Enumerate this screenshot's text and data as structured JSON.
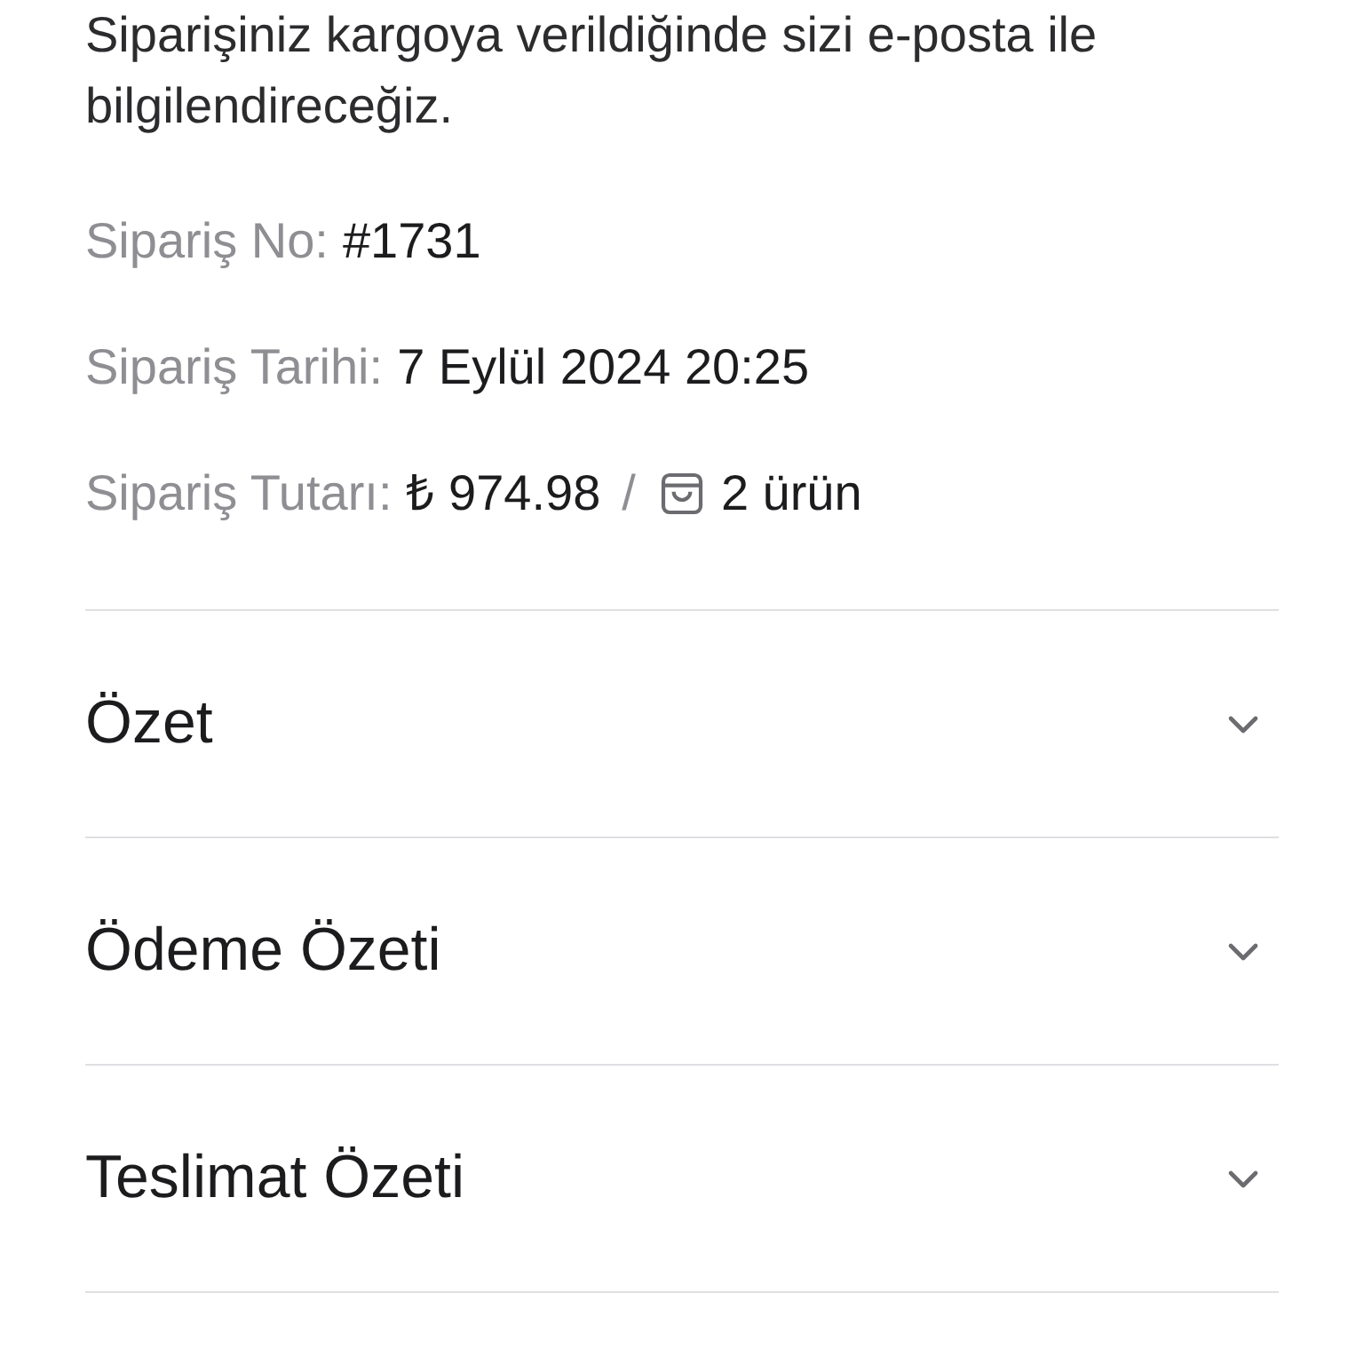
{
  "message": "Siparişiniz kargoya verildiğinde sizi e-posta ile bilgilendireceğiz.",
  "order": {
    "number_label": "Sipariş No:",
    "number": "#1731",
    "date_label": "Sipariş Tarihi:",
    "date": "7 Eylül 2024 20:25",
    "total_label": "Sipariş Tutarı:",
    "total": "₺ 974.98",
    "separator": "/",
    "items": "2 ürün"
  },
  "sections": [
    {
      "title": "Özet",
      "expanded": false
    },
    {
      "title": "Ödeme Özeti",
      "expanded": false
    },
    {
      "title": "Teslimat Özeti",
      "expanded": false
    }
  ]
}
